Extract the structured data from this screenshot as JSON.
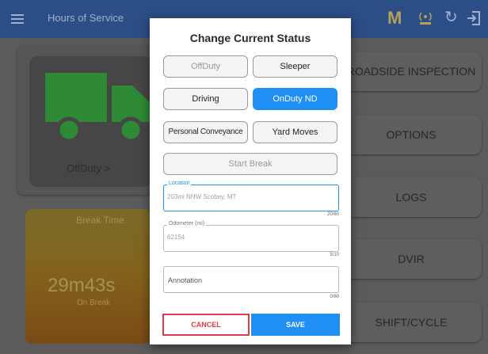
{
  "app": {
    "title": "Hours of Service",
    "m_label": "M",
    "icons": [
      "menu-icon",
      "eld-connection-icon",
      "refresh-icon",
      "logout-icon"
    ]
  },
  "status_card": {
    "label": "OffDuty >"
  },
  "break_card": {
    "title": "Break Time",
    "time": "29m43s",
    "subtitle": "On Break"
  },
  "menu": [
    {
      "label": "ROADSIDE INSPECTION"
    },
    {
      "label": "OPTIONS"
    },
    {
      "label": "LOGS"
    },
    {
      "label": "DVIR"
    },
    {
      "label": "SHIFT/CYCLE"
    }
  ],
  "dialog": {
    "title": "Change Current Status",
    "buttons": {
      "offduty": "OffDuty",
      "sleeper": "Sleeper",
      "driving": "Driving",
      "onduty_nd": "OnDuty ND",
      "personal_conveyance": "Personal Conveyance",
      "yard_moves": "Yard Moves",
      "start_break": "Start Break"
    },
    "location": {
      "label": "Location",
      "value": "203mi NNW Scobey, MT",
      "counter": "20/60"
    },
    "odometer": {
      "label": "Odometer (mi)",
      "value": "62154",
      "counter": "5/10"
    },
    "annotation": {
      "placeholder": "Annotation",
      "counter": "0/60"
    },
    "cancel": "CANCEL",
    "save": "SAVE"
  },
  "colors": {
    "appbar": "#2c4e86",
    "accent": "#1f8ff3",
    "cancel": "#e03a48",
    "truck": "#2f8a35",
    "break_card": "#83641b"
  }
}
